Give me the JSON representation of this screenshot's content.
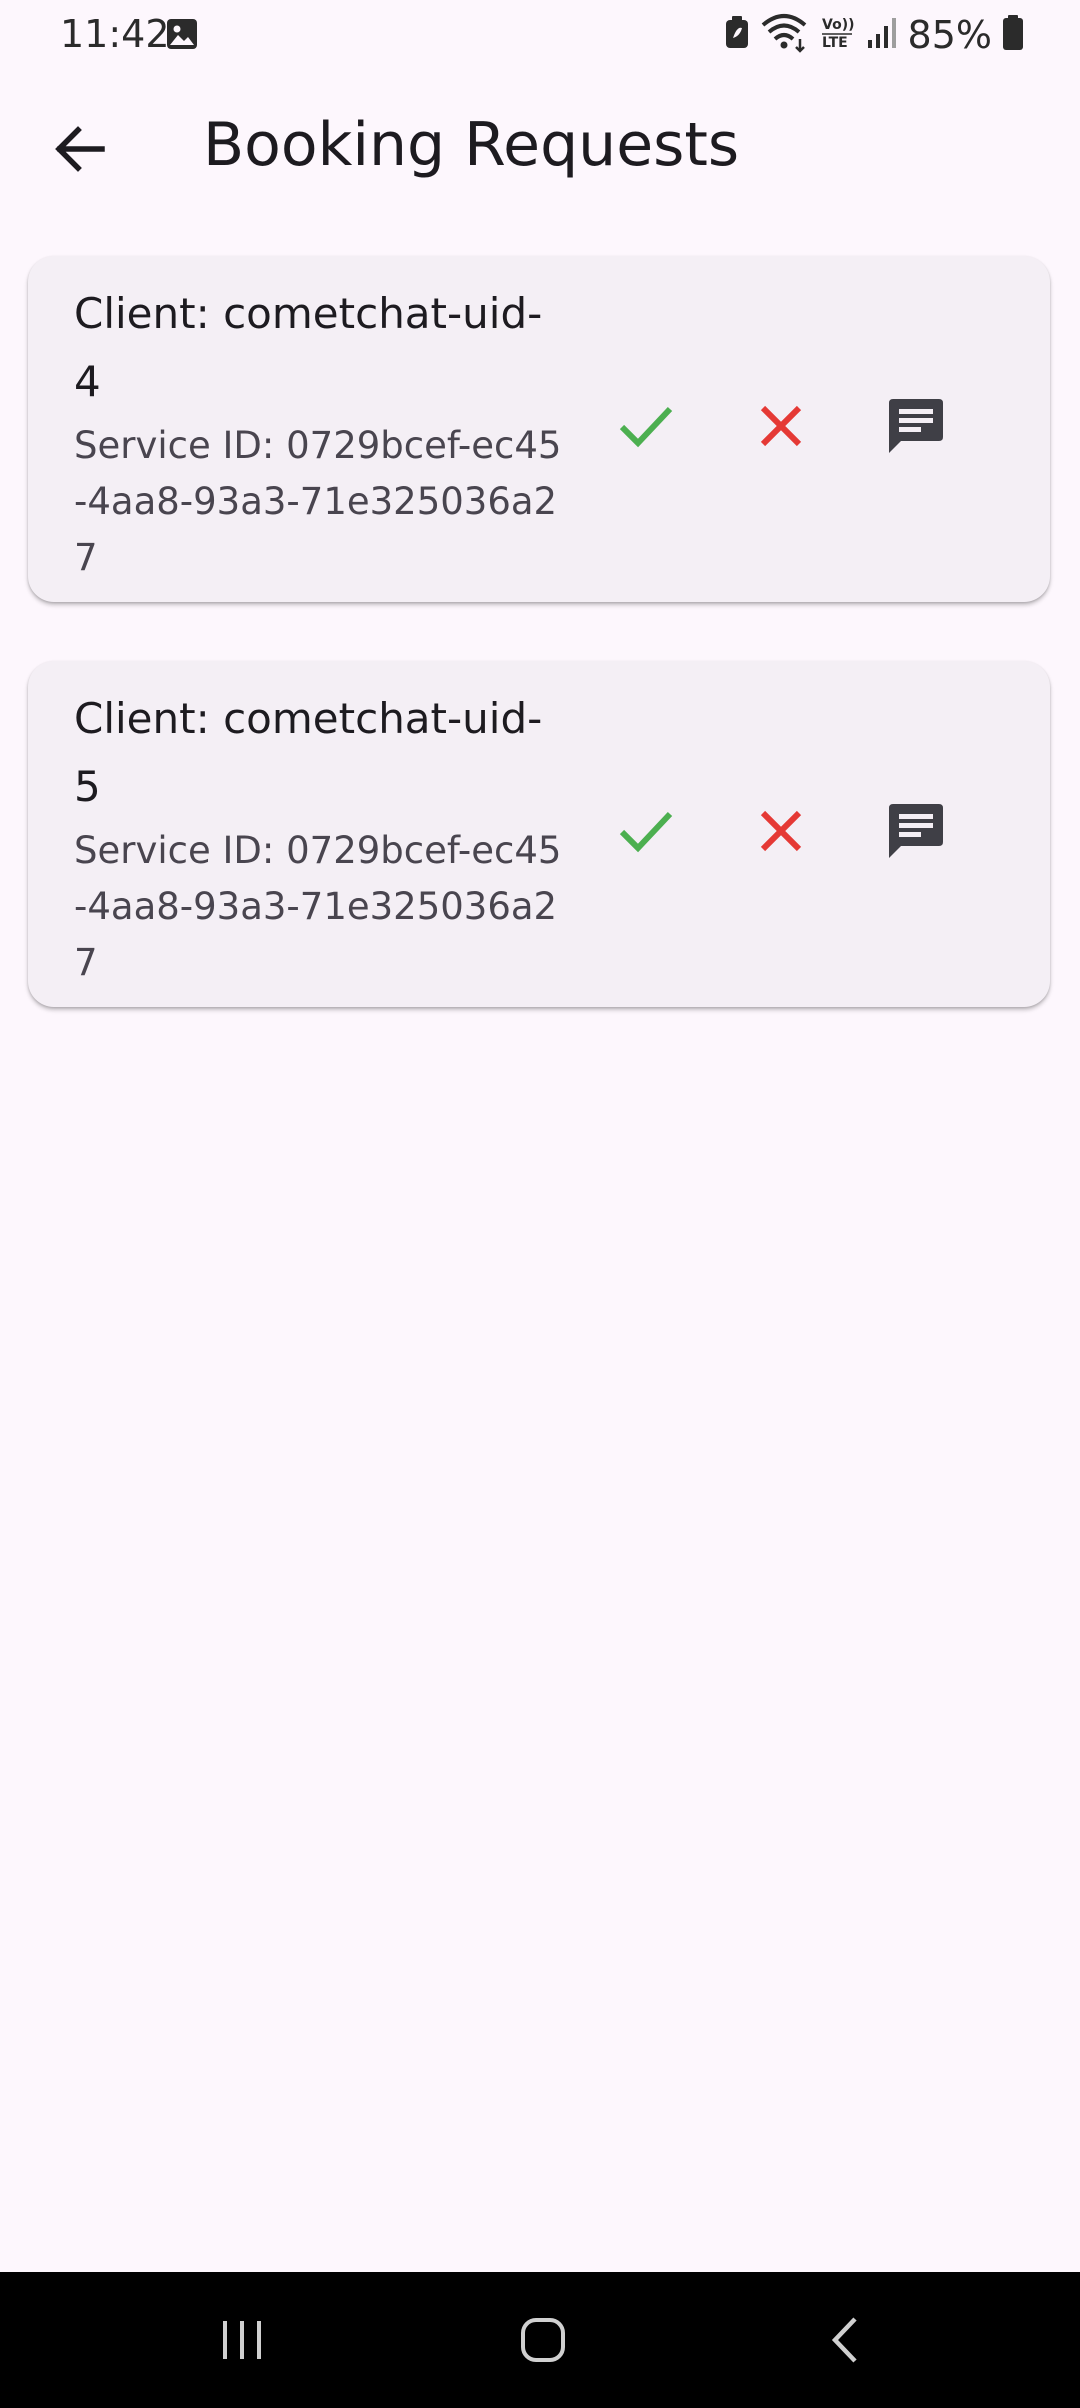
{
  "status_bar": {
    "time": "11:42",
    "battery": "85%",
    "icons": [
      "gallery-icon",
      "battery-saver-icon",
      "wifi-icon",
      "volte-icon",
      "signal-icon",
      "battery-icon"
    ]
  },
  "app_bar": {
    "title": "Booking Requests",
    "back_icon": "arrow-back-icon"
  },
  "requests": [
    {
      "client": "Client: cometchat-uid-4",
      "service": "Service ID: 0729bcef-ec45-4aa8-93a3-71e325036a27"
    },
    {
      "client": "Client: cometchat-uid-5",
      "service": "Service ID: 0729bcef-ec45-4aa8-93a3-71e325036a27"
    }
  ],
  "actions": {
    "accept_icon": "check-icon",
    "reject_icon": "close-icon",
    "chat_icon": "chat-icon"
  },
  "colors": {
    "background": "#fdf7fd",
    "card": "#f4eff5",
    "accept": "#4caf50",
    "reject": "#e53935",
    "chat": "#3f3f46"
  },
  "nav_bar": {
    "items": [
      "recent-apps-icon",
      "home-icon",
      "back-icon"
    ]
  }
}
